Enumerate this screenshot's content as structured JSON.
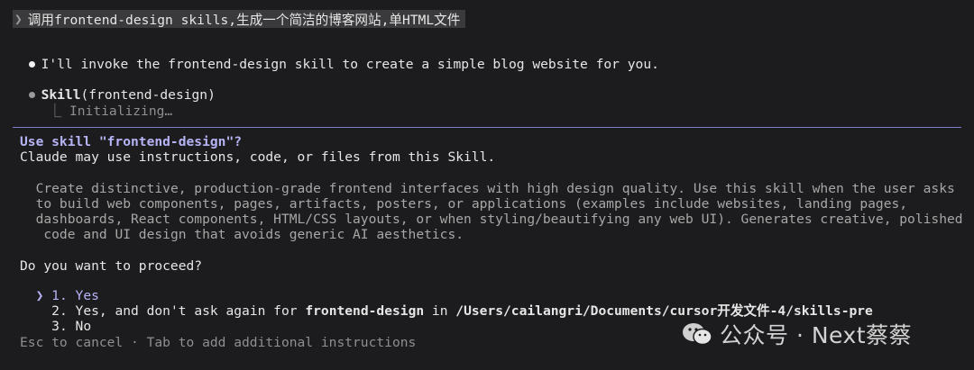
{
  "prompt": {
    "chevron": "❯",
    "text": "调用frontend-design skills,生成一个简洁的博客网站,单HTML文件"
  },
  "assistant": {
    "message": "I'll invoke the frontend-design skill to create a simple blog website for you."
  },
  "tool_call": {
    "name": "Skill",
    "arg": "(frontend-design)",
    "status_prefix": "⎿",
    "status": "Initializing…"
  },
  "dialog": {
    "title": "Use skill \"frontend-design\"?",
    "subtitle": "Claude may use instructions, code, or files from this Skill.",
    "description_lines": [
      "Create distinctive, production-grade frontend interfaces with high design quality. Use this skill when the user asks",
      "to build web components, pages, artifacts, posters, or applications (examples include websites, landing pages,",
      "dashboards, React components, HTML/CSS layouts, or when styling/beautifying any web UI). Generates creative, polished",
      " code and UI design that avoids generic AI aesthetics."
    ],
    "question": "Do you want to proceed?",
    "selected_chevron": "❯",
    "options": {
      "opt1": {
        "num": "1.",
        "label": "Yes"
      },
      "opt2": {
        "num": "2.",
        "label_a": "Yes, and don't ask again for ",
        "label_bold": "frontend-design",
        "label_b": " in ",
        "label_path": "/Users/cailangri/Documents/cursor开发文件-4/skills-pre"
      },
      "opt3": {
        "num": "3.",
        "label": "No"
      }
    },
    "footer": "Esc to cancel · Tab to add additional instructions"
  },
  "watermark": {
    "text": "公众号 · Next蔡蔡",
    "icon": "wechat-icon"
  },
  "colors": {
    "background": "#1c1c1e",
    "accent": "#b7b4f6",
    "separator": "#7f7fcf"
  }
}
